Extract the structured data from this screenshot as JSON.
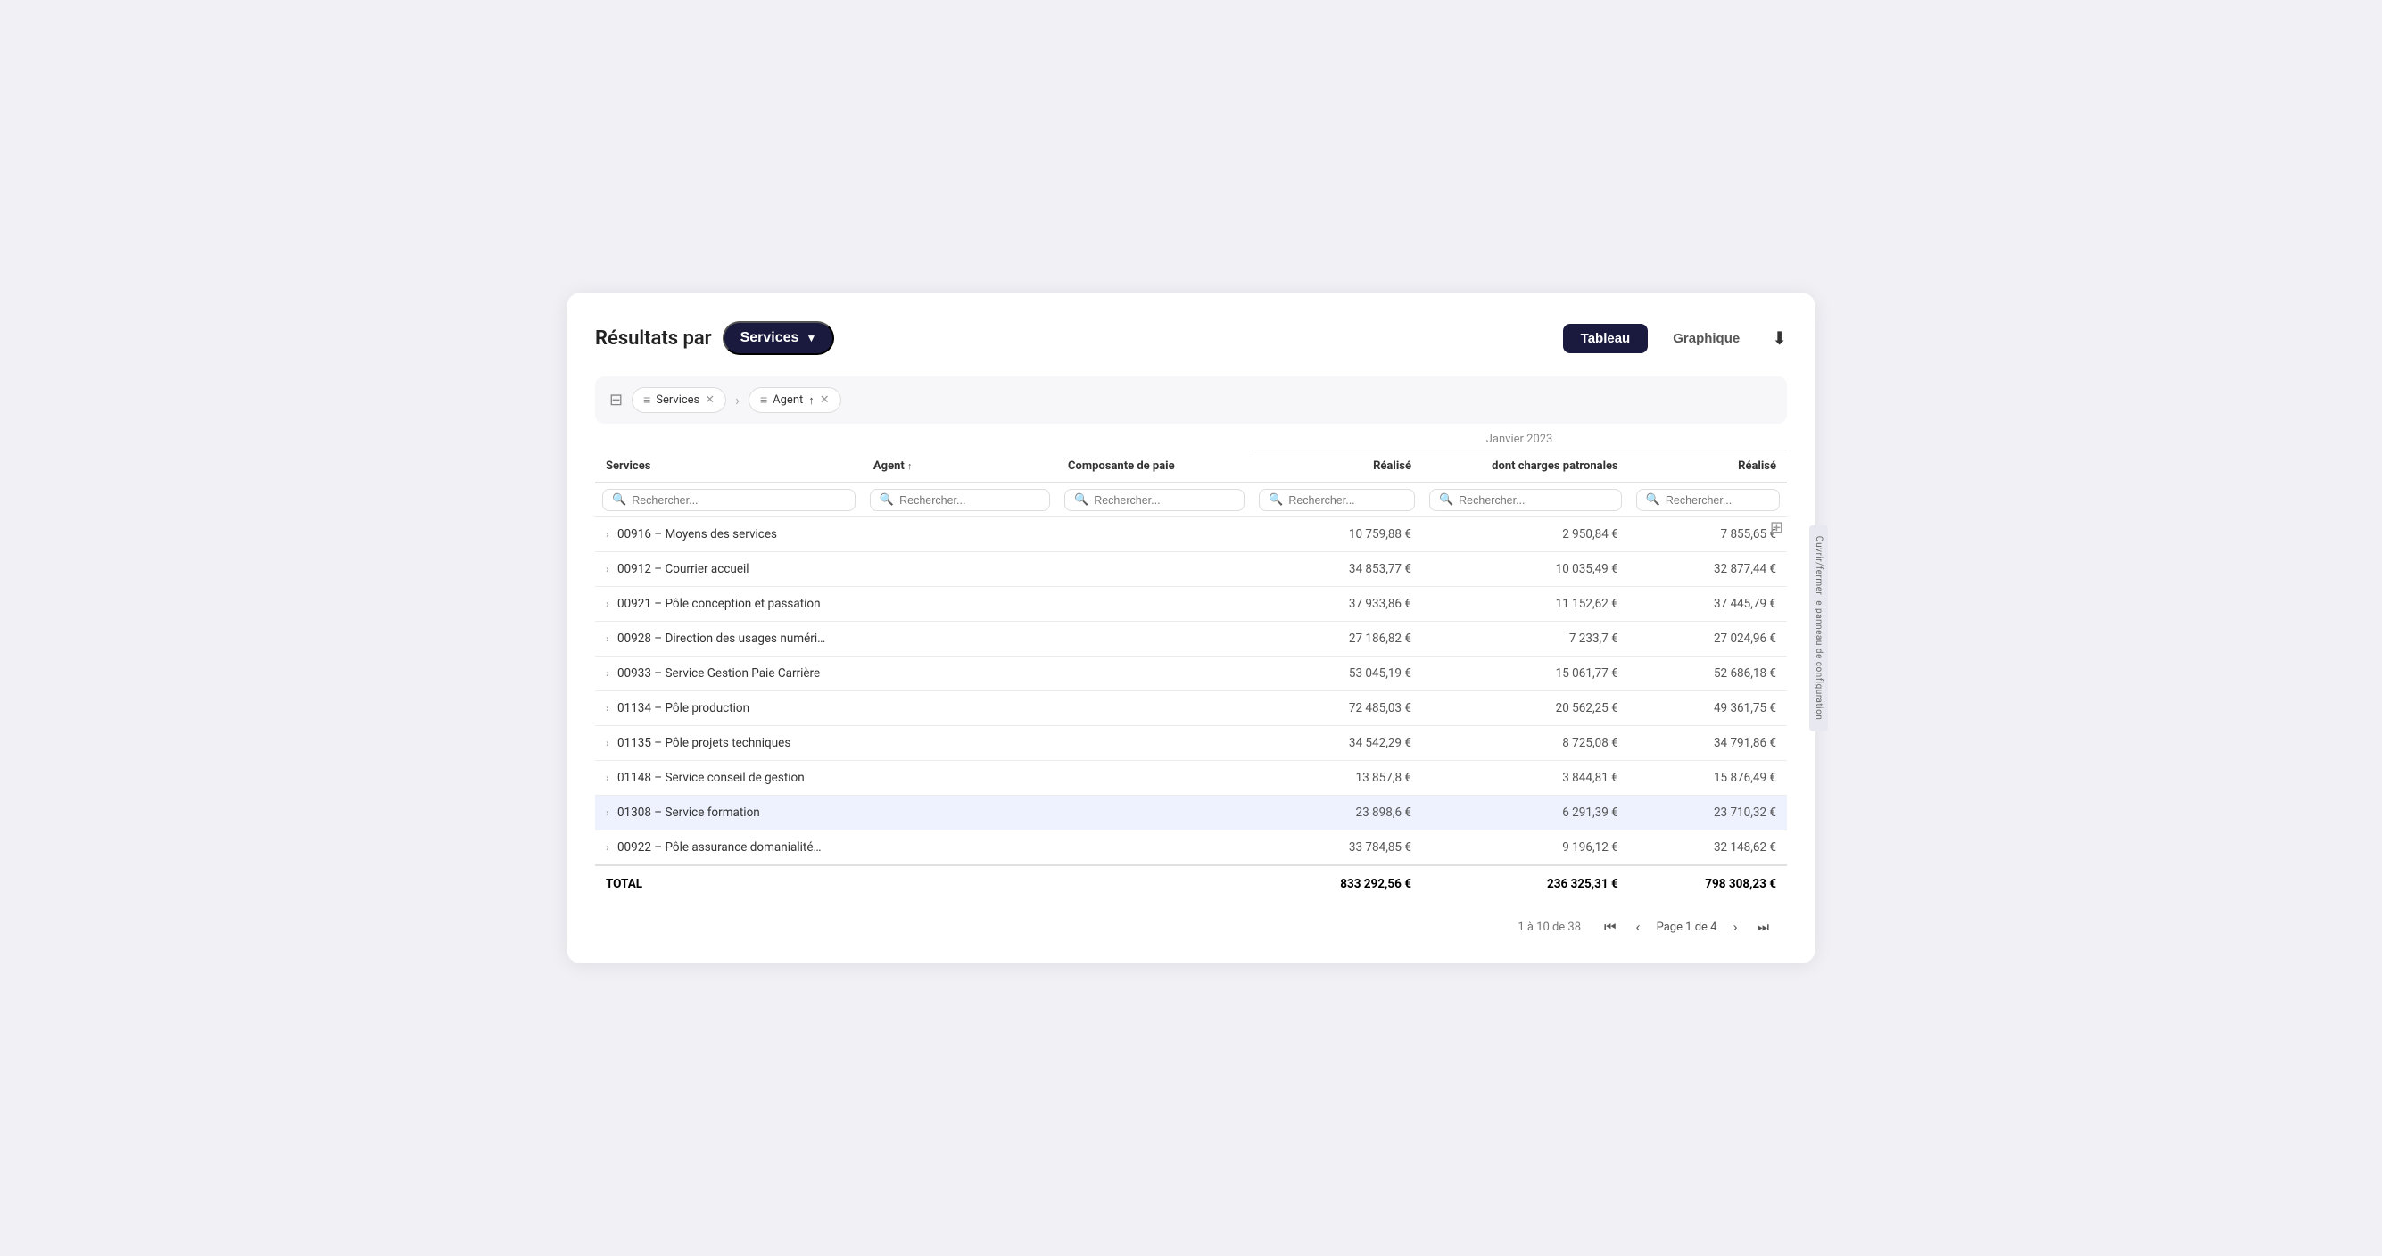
{
  "header": {
    "resultats_label": "Résultats par",
    "services_label": "Services",
    "tab_tableau": "Tableau",
    "tab_graphique": "Graphique",
    "download_icon": "⬇"
  },
  "filters": {
    "filter_icon": "≡",
    "chip1_icon": "≡",
    "chip1_label": "Services",
    "chip2_icon": "≡",
    "chip2_label": "Agent",
    "chip2_sort_icon": "↑"
  },
  "table": {
    "month_label": "Janvier 2023",
    "columns": [
      {
        "key": "services",
        "label": "Services",
        "sortable": false
      },
      {
        "key": "agent",
        "label": "Agent",
        "sortable": true
      },
      {
        "key": "composante",
        "label": "Composante de paie",
        "sortable": false
      },
      {
        "key": "realise1",
        "label": "Réalisé",
        "sortable": false,
        "align": "right"
      },
      {
        "key": "charges",
        "label": "dont charges patronales",
        "sortable": false,
        "align": "right"
      },
      {
        "key": "realise2",
        "label": "Réalisé",
        "sortable": false,
        "align": "right"
      }
    ],
    "search_placeholder": "Rechercher...",
    "rows": [
      {
        "id": "r1",
        "service": "00916 – Moyens des services",
        "agent": "",
        "composante": "",
        "realise1": "10 759,88 €",
        "charges": "2 950,84 €",
        "realise2": "7 855,65 €",
        "highlighted": false
      },
      {
        "id": "r2",
        "service": "00912 – Courrier accueil",
        "agent": "",
        "composante": "",
        "realise1": "34 853,77 €",
        "charges": "10 035,49 €",
        "realise2": "32 877,44 €",
        "highlighted": false
      },
      {
        "id": "r3",
        "service": "00921 – Pôle conception et passation",
        "agent": "",
        "composante": "",
        "realise1": "37 933,86 €",
        "charges": "11 152,62 €",
        "realise2": "37 445,79 €",
        "highlighted": false
      },
      {
        "id": "r4",
        "service": "00928 – Direction des usages numéri…",
        "agent": "",
        "composante": "",
        "realise1": "27 186,82 €",
        "charges": "7 233,7 €",
        "realise2": "27 024,96 €",
        "highlighted": false
      },
      {
        "id": "r5",
        "service": "00933 – Service Gestion Paie Carrière",
        "agent": "",
        "composante": "",
        "realise1": "53 045,19 €",
        "charges": "15 061,77 €",
        "realise2": "52 686,18 €",
        "highlighted": false
      },
      {
        "id": "r6",
        "service": "01134 – Pôle production",
        "agent": "",
        "composante": "",
        "realise1": "72 485,03 €",
        "charges": "20 562,25 €",
        "realise2": "49 361,75 €",
        "highlighted": false
      },
      {
        "id": "r7",
        "service": "01135 – Pôle projets techniques",
        "agent": "",
        "composante": "",
        "realise1": "34 542,29 €",
        "charges": "8 725,08 €",
        "realise2": "34 791,86 €",
        "highlighted": false
      },
      {
        "id": "r8",
        "service": "01148 – Service conseil de gestion",
        "agent": "",
        "composante": "",
        "realise1": "13 857,8 €",
        "charges": "3 844,81 €",
        "realise2": "15 876,49 €",
        "highlighted": false
      },
      {
        "id": "r9",
        "service": "01308 – Service formation",
        "agent": "",
        "composante": "",
        "realise1": "23 898,6 €",
        "charges": "6 291,39 €",
        "realise2": "23 710,32 €",
        "highlighted": true
      },
      {
        "id": "r10",
        "service": "00922 – Pôle assurance domanialité…",
        "agent": "",
        "composante": "",
        "realise1": "33 784,85 €",
        "charges": "9 196,12 €",
        "realise2": "32 148,62 €",
        "highlighted": false
      }
    ],
    "footer": {
      "total_label": "TOTAL",
      "realise1": "833 292,56 €",
      "charges": "236 325,31 €",
      "realise2": "798 308,23 €"
    }
  },
  "pagination": {
    "range_label": "1 à 10 de 38",
    "page_label": "Page 1 de 4",
    "first_icon": "⏮",
    "prev_icon": "‹",
    "next_icon": "›",
    "last_icon": "⏭"
  },
  "side_panel": {
    "label": "Ouvrir/fermer le panneau de configuration"
  }
}
